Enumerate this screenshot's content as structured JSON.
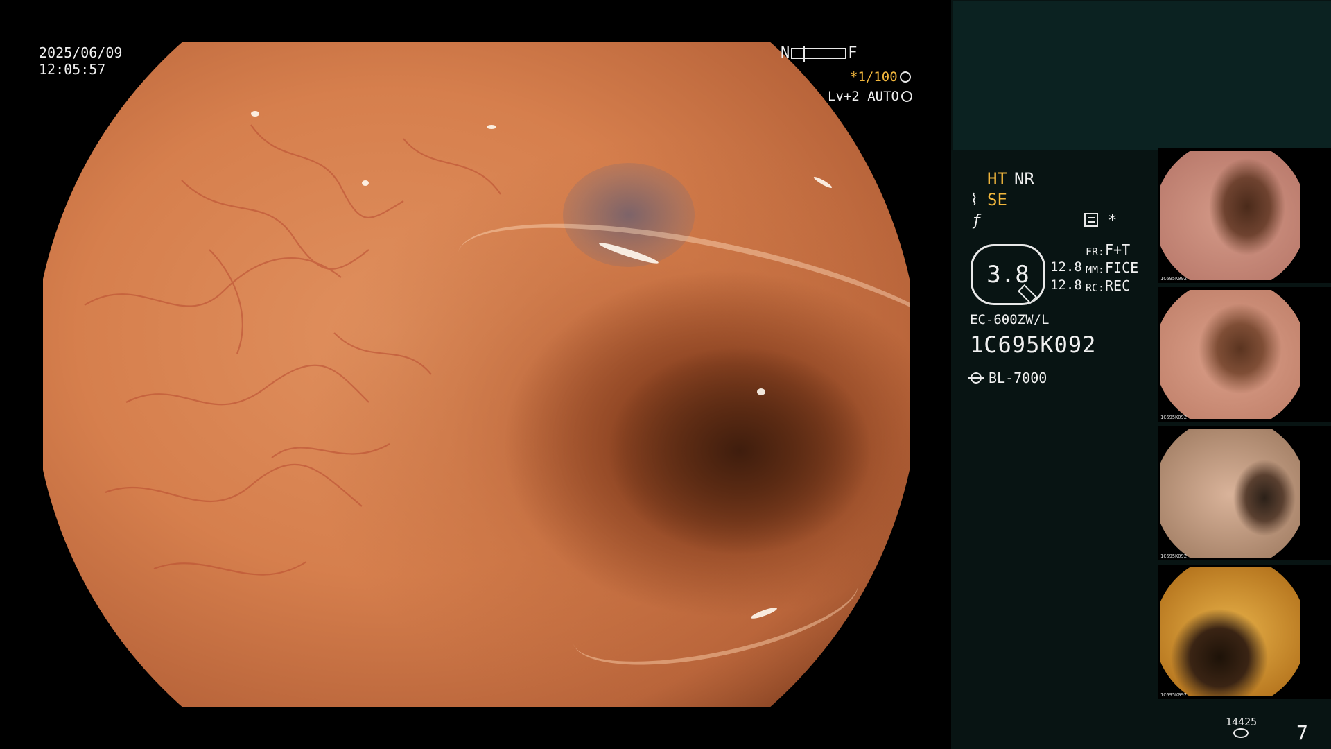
{
  "overlay": {
    "date": "2025/06/09",
    "time": "12:05:57",
    "nf_left": "N",
    "nf_right": "F",
    "shutter": "*1/100",
    "level": "Lv+2 AUTO"
  },
  "panel": {
    "mode_ht": "HT",
    "mode_nr": "NR",
    "mode_se": "SE",
    "zoom": "3.8",
    "values": [
      "12.8",
      "12.8"
    ],
    "param_labels": [
      "FR:",
      "MM:",
      "RC:"
    ],
    "param_values": [
      "F+T",
      "FICE",
      "REC"
    ],
    "scope_model": "EC-600ZW/L",
    "serial": "1C695K092",
    "light_source": "BL-7000"
  },
  "thumbnails": [
    {
      "meta": "1C695K092"
    },
    {
      "meta": "1C695K092"
    },
    {
      "meta": "1C695K092"
    },
    {
      "meta": "1C695K092"
    }
  ],
  "footer": {
    "count": "14425",
    "page": "7"
  },
  "colors": {
    "accent": "#f1b63c",
    "panel_bg": "#081413",
    "panel_top_bg": "#0b2221",
    "text": "#f0f0f0"
  },
  "icons": [
    "settings-icon",
    "star-icon",
    "shutter-icon",
    "auto-icon",
    "light-icon",
    "disk-icon",
    "zoom-lens-icon"
  ]
}
